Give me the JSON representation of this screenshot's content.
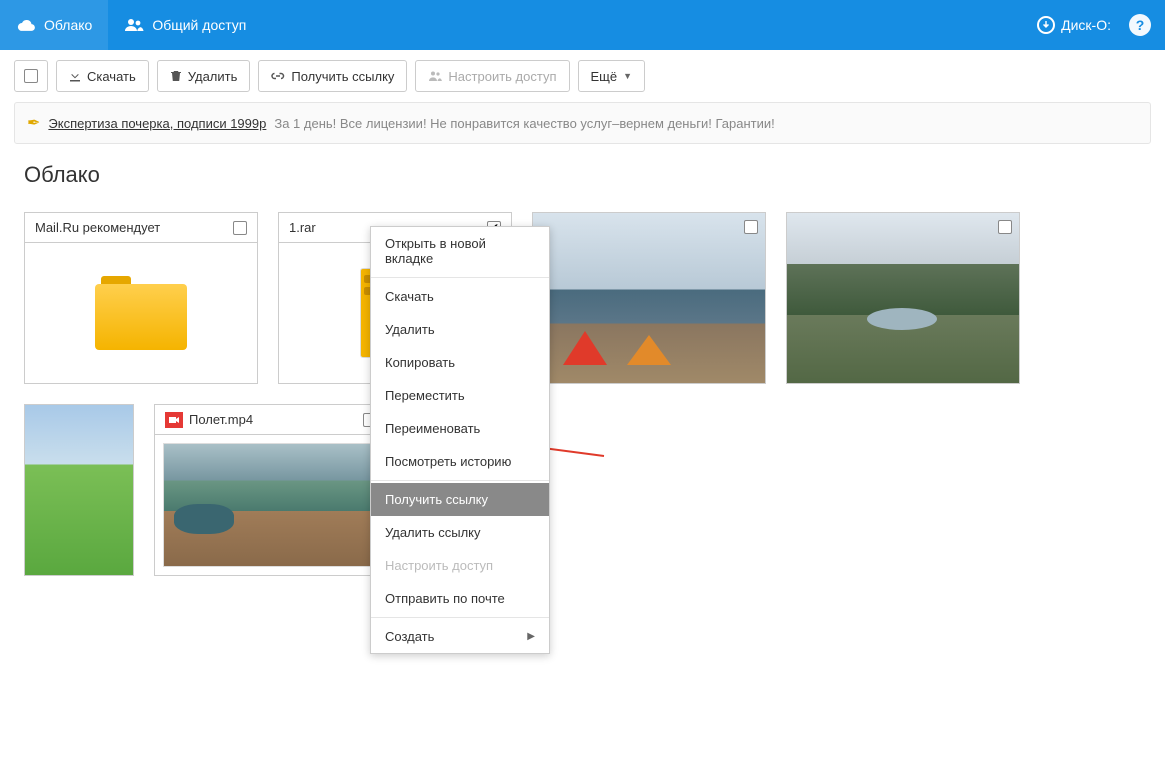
{
  "topnav": {
    "cloud": "Облако",
    "shared": "Общий доступ",
    "disk": "Диск-О:"
  },
  "toolbar": {
    "download": "Скачать",
    "delete": "Удалить",
    "getlink": "Получить ссылку",
    "access": "Настроить доступ",
    "more": "Ещё"
  },
  "ad": {
    "link": "Экспертиза почерка, подписи 1999р",
    "text": "За 1 день! Все лицензии! Не понравится качество услуг–вернем деньги! Гарантии!"
  },
  "breadcrumb": "Облако",
  "tiles": {
    "rec": "Mail.Ru рекомендует",
    "rar": "1.rar",
    "mp4": "Полет.mp4"
  },
  "ctx": {
    "open_tab": "Открыть в новой вкладке",
    "download": "Скачать",
    "delete": "Удалить",
    "copy": "Копировать",
    "move": "Переместить",
    "rename": "Переименовать",
    "history": "Посмотреть историю",
    "getlink": "Получить ссылку",
    "dellink": "Удалить ссылку",
    "access": "Настроить доступ",
    "email": "Отправить по почте",
    "create": "Создать"
  }
}
